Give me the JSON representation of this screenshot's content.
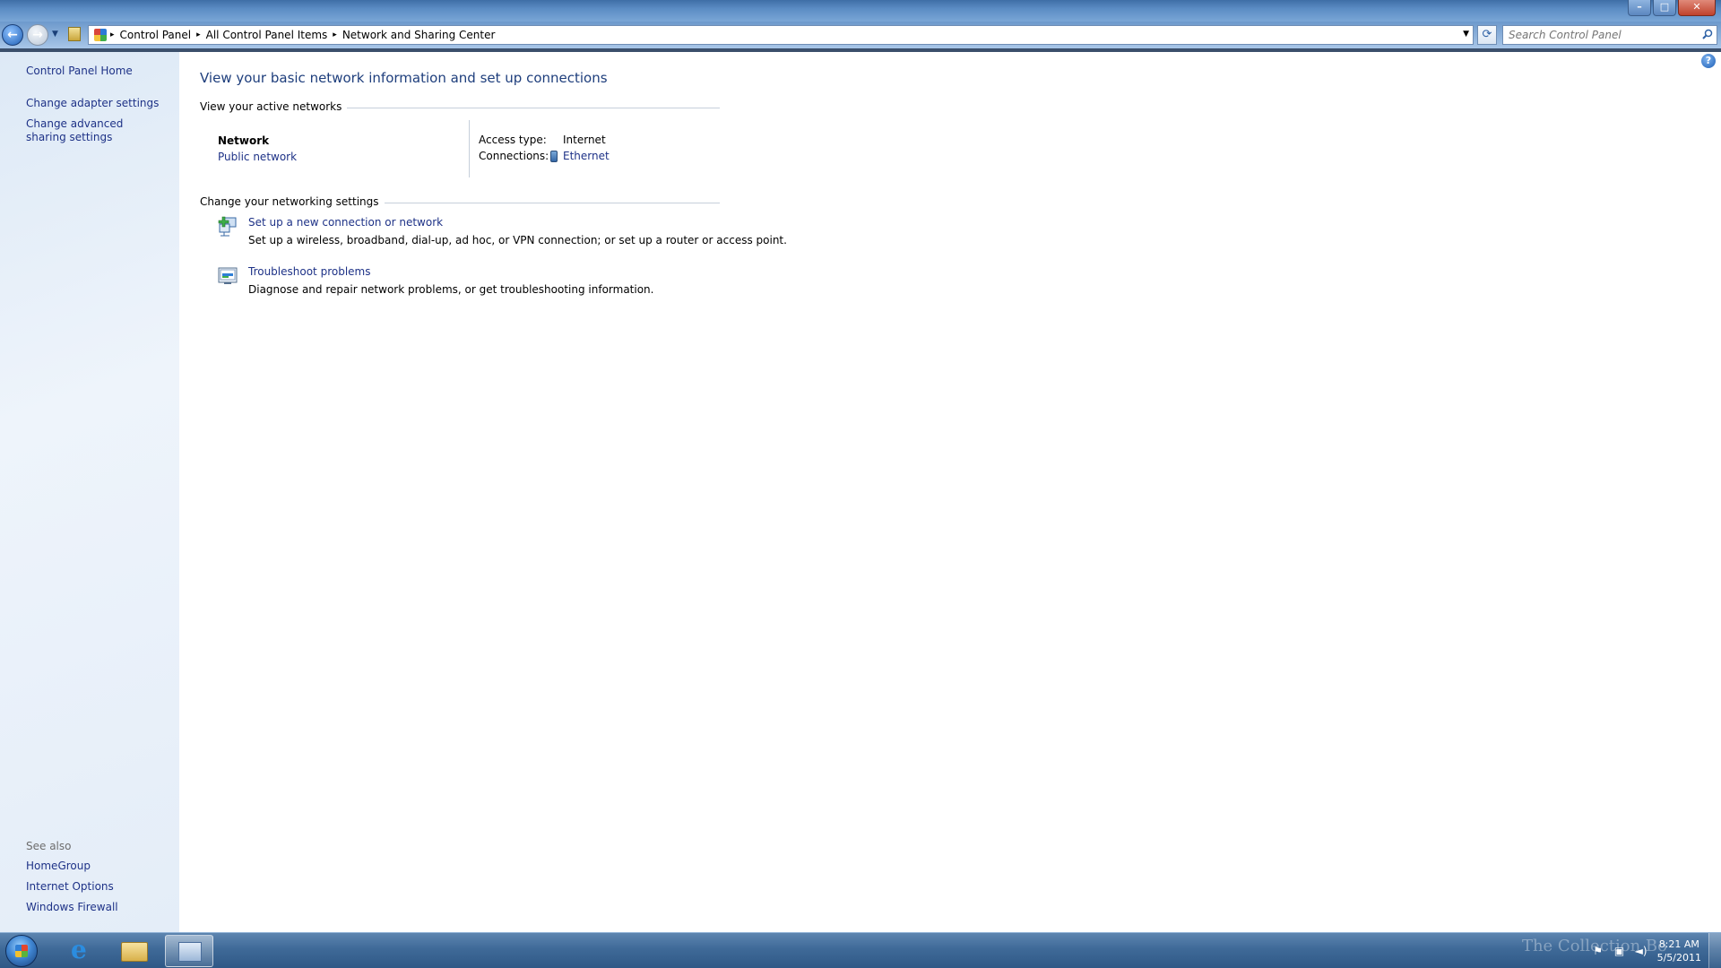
{
  "window": {
    "controls": {
      "minimize": "–",
      "maximize": "□",
      "close": "✕"
    }
  },
  "address_bar": {
    "breadcrumbs": [
      "Control Panel",
      "All Control Panel Items",
      "Network and Sharing Center"
    ],
    "separator": "▸",
    "search_placeholder": "Search Control Panel",
    "back_glyph": "←",
    "forward_glyph": "→",
    "refresh_glyph": "⟳"
  },
  "sidebar": {
    "links": [
      "Control Panel Home",
      "Change adapter settings",
      "Change advanced sharing settings"
    ],
    "see_also_label": "See also",
    "see_also": [
      "HomeGroup",
      "Internet Options",
      "Windows Firewall"
    ]
  },
  "main": {
    "title": "View your basic network information and set up connections",
    "active_networks_header": "View your active networks",
    "network": {
      "name": "Network",
      "type": "Public network",
      "access_type_label": "Access type:",
      "access_type_value": "Internet",
      "connections_label": "Connections:",
      "connections_value": "Ethernet"
    },
    "change_settings_header": "Change your networking settings",
    "tasks": [
      {
        "title": "Set up a new connection or network",
        "description": "Set up a wireless, broadband, dial-up, ad hoc, or VPN connection; or set up a router or access point.",
        "icon": "network-setup-icon"
      },
      {
        "title": "Troubleshoot problems",
        "description": "Diagnose and repair network problems, or get troubleshooting information.",
        "icon": "troubleshoot-icon"
      }
    ],
    "help_glyph": "?"
  },
  "taskbar": {
    "clock_time": "8:21 AM",
    "clock_date": "5/5/2011",
    "watermark": "The Collection Bo",
    "tray_icons": [
      "flag-icon",
      "network-icon",
      "volume-icon"
    ]
  }
}
